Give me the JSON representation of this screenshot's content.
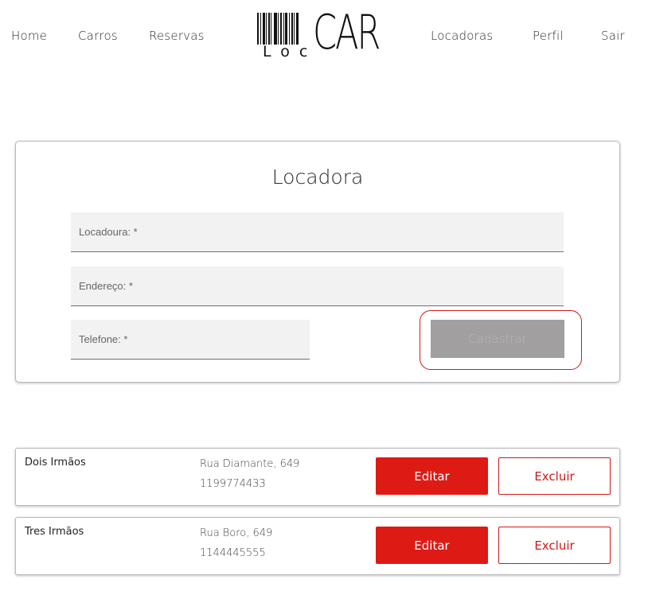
{
  "nav": {
    "left": [
      {
        "label": "Home"
      },
      {
        "label": "Carros"
      },
      {
        "label": "Reservas"
      }
    ],
    "right": [
      {
        "label": "Locadoras"
      },
      {
        "label": "Perfil"
      },
      {
        "label": "Sair"
      }
    ],
    "logo": {
      "loc": "Loc",
      "car": "CAR"
    }
  },
  "form": {
    "title": "Locadora",
    "locadora": {
      "placeholder": "Locadoura: *",
      "value": ""
    },
    "endereco": {
      "placeholder": "Endereço: *",
      "value": ""
    },
    "telefone": {
      "placeholder": "Telefone: *",
      "value": ""
    },
    "submit_label": "Cadastrar"
  },
  "locadoras": [
    {
      "name": "Dois Irmãos",
      "address": "Rua Diamante, 649",
      "phone": "1199774433",
      "edit_label": "Editar",
      "delete_label": "Excluir"
    },
    {
      "name": "Tres Irmãos",
      "address": "Rua Boro, 649",
      "phone": "1144445555",
      "edit_label": "Editar",
      "delete_label": "Excluir"
    }
  ],
  "colors": {
    "accent": "#de1a14",
    "disabled_button": "#a19f9f",
    "field_background": "#f2f2f2"
  }
}
